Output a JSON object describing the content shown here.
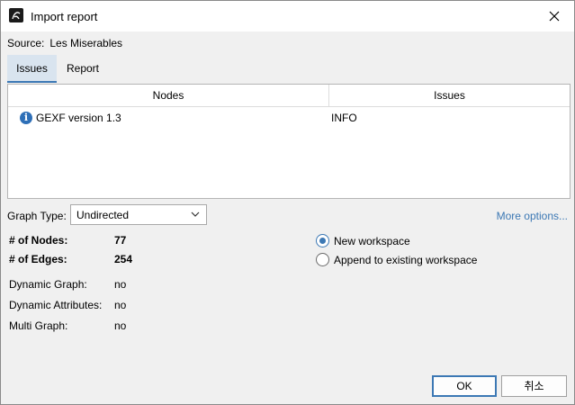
{
  "window": {
    "title": "Import report",
    "icon": "gephi-app-icon"
  },
  "source": {
    "label": "Source:",
    "value": "Les Miserables"
  },
  "tabs": [
    {
      "label": "Issues",
      "active": true
    },
    {
      "label": "Report",
      "active": false
    }
  ],
  "table": {
    "headers": [
      "Nodes",
      "Issues"
    ],
    "rows": [
      {
        "icon": "info-icon",
        "node": "GEXF version 1.3",
        "issue": "INFO"
      }
    ]
  },
  "graph_type": {
    "label": "Graph Type:",
    "value": "Undirected"
  },
  "more_options": "More options...",
  "stats": [
    {
      "label": "# of Nodes:",
      "value": "77",
      "bold": true
    },
    {
      "label": "# of Edges:",
      "value": "254",
      "bold": true
    },
    {
      "label": "Dynamic Graph:",
      "value": "no",
      "bold": false
    },
    {
      "label": "Dynamic Attributes:",
      "value": "no",
      "bold": false
    },
    {
      "label": "Multi Graph:",
      "value": "no",
      "bold": false
    }
  ],
  "workspace_options": [
    {
      "label": "New workspace",
      "selected": true
    },
    {
      "label": "Append to existing workspace",
      "selected": false
    }
  ],
  "buttons": {
    "ok": "OK",
    "cancel": "취소"
  },
  "colors": {
    "accent": "#3c78b4",
    "info_icon": "#2e6fb7",
    "tab_active_bg": "#d9e4ef"
  }
}
